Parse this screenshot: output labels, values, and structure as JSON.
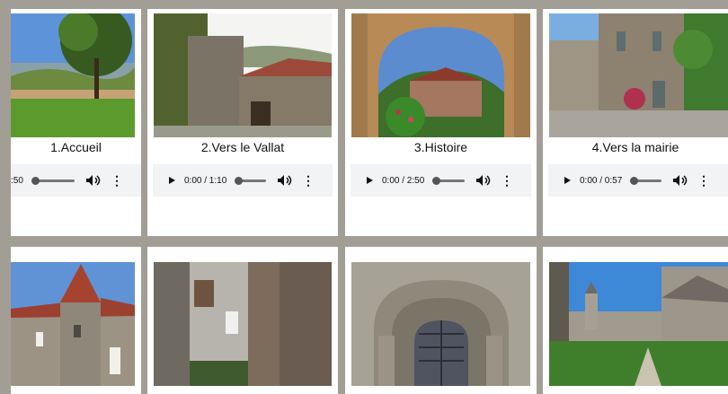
{
  "tracks": [
    {
      "title": "1.Accueil",
      "time": ":50"
    },
    {
      "title": "2.Vers le Vallat",
      "time": "0:00 / 1:10"
    },
    {
      "title": "3.Histoire",
      "time": "0:00 / 2:50"
    },
    {
      "title": "4.Vers la mairie",
      "time": "0:00 / 0:57"
    }
  ],
  "icons": {
    "play": "play-icon",
    "volume": "volume-icon",
    "more": "more-options-icon"
  },
  "colors": {
    "page_bg": "#a39e95",
    "card_bg": "#ffffff",
    "player_bg": "#f1f3f4"
  }
}
